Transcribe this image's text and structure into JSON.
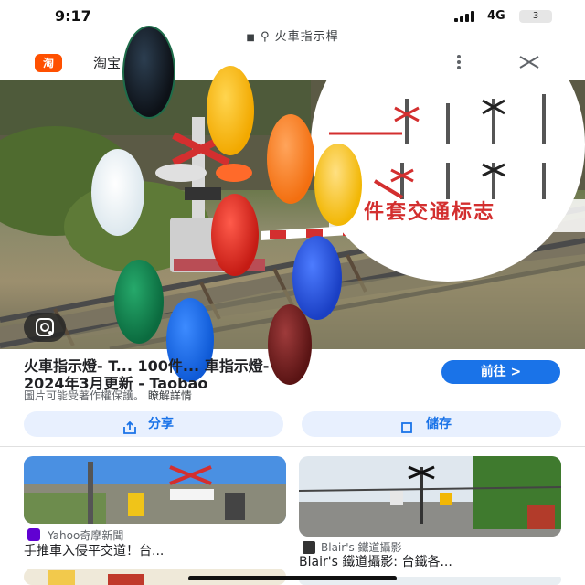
{
  "status_bar": {
    "time": "9:17",
    "network": "4G",
    "battery": "3"
  },
  "address_bar": {
    "url_text": "火車指示桿"
  },
  "site_header": {
    "logo_text": "淘",
    "site_name": "淘宝"
  },
  "hero_image": {
    "alt": "火車指示燈",
    "banner_text": "件套交通标志"
  },
  "result": {
    "title_line1": "火車指示燈- T... 100件... 車指示燈-",
    "title_line2": "2024年3月更新 - Taobao",
    "copyright_text": "圖片可能受著作權保護。",
    "learn_more": "瞭解詳情",
    "visit_label": "前往 >"
  },
  "actions": {
    "share_label": "分享",
    "save_label": "儲存"
  },
  "related": [
    {
      "source": "Yahoo奇摩新聞",
      "title": "手推車入侵平交道！台..."
    },
    {
      "source": "Blair's 鐵道攝影",
      "title": "Blair's 鐵道攝影: 台鐵各..."
    }
  ],
  "colors": {
    "accent_blue": "#1a73e8",
    "pill_bg": "#e8f0fe",
    "taobao_orange": "#ff5000",
    "yahoo_purple": "#6001d2"
  },
  "icons": [
    "lock-icon",
    "search-icon",
    "more-vert-icon",
    "close-icon",
    "google-lens-icon",
    "share-icon",
    "bookmark-icon"
  ]
}
